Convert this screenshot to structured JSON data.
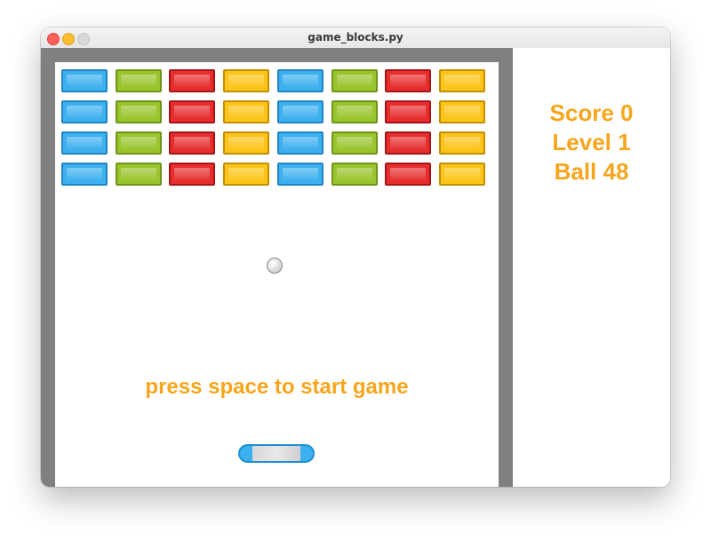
{
  "window": {
    "title": "game_blocks.py"
  },
  "hud": {
    "score_text": "Score 0",
    "level_text": "Level 1",
    "ball_text": "Ball 48"
  },
  "game": {
    "prompt": "press space to start game",
    "brick_rows": 4,
    "brick_columns": 8,
    "brick_column_colors": [
      "blue",
      "green",
      "red",
      "yellow",
      "blue",
      "green",
      "red",
      "yellow"
    ]
  },
  "colors": {
    "hud_text": "#f7a51c",
    "frame": "#808080",
    "blue": "#3db0ef",
    "green": "#99c42c",
    "red": "#e62e2e",
    "yellow": "#fcc418"
  },
  "icons": {
    "ball": "ball-icon",
    "paddle": "paddle-icon"
  }
}
